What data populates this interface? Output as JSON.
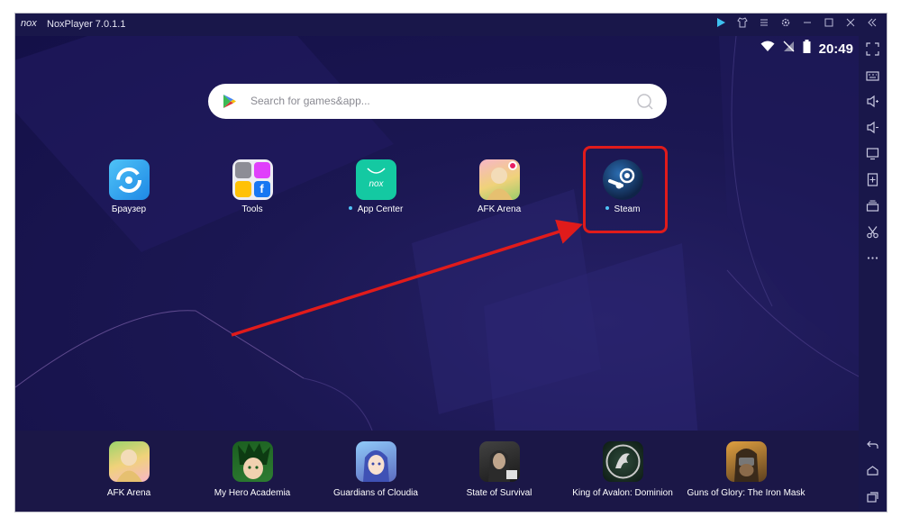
{
  "window": {
    "logo": "nox",
    "title": "NoxPlayer 7.0.1.1",
    "controls": [
      "play-icon",
      "shirt-icon",
      "menu-icon",
      "gear-icon",
      "minimize-icon",
      "maximize-icon",
      "close-icon",
      "collapse-icon"
    ]
  },
  "status": {
    "time": "20:49",
    "icons": [
      "wifi-icon",
      "no-signal-icon",
      "battery-icon"
    ]
  },
  "search": {
    "placeholder": "Search for games&app..."
  },
  "apps": [
    {
      "label": "Браузер",
      "icon": "browser-icon",
      "dot": false
    },
    {
      "label": "Tools",
      "icon": "tools-icon",
      "dot": false
    },
    {
      "label": "App Center",
      "icon": "app-center-icon",
      "dot": true
    },
    {
      "label": "AFK Arena",
      "icon": "afk-arena-icon",
      "dot": false
    },
    {
      "label": "Steam",
      "icon": "steam-icon",
      "dot": true
    }
  ],
  "dock": [
    {
      "label": "AFK Arena",
      "icon": "afk-arena-icon"
    },
    {
      "label": "My Hero Academia",
      "icon": "my-hero-academia-icon"
    },
    {
      "label": "Guardians of Cloudia",
      "icon": "guardians-of-cloudia-icon"
    },
    {
      "label": "State of Survival",
      "icon": "state-of-survival-icon"
    },
    {
      "label": "King of Avalon: Dominion",
      "icon": "king-of-avalon-icon"
    },
    {
      "label": "Guns of Glory: The Iron Mask",
      "icon": "guns-of-glory-icon"
    }
  ],
  "sidebar": [
    "fullscreen-icon",
    "keyboard-icon",
    "volume-up-icon",
    "volume-down-icon",
    "screen-icon",
    "add-apk-icon",
    "multi-instance-icon",
    "scissors-icon",
    "more-icon",
    "back-icon",
    "home-icon",
    "recent-apps-icon"
  ],
  "colors": {
    "accent_red": "#e01b1b",
    "background": "#1a1550",
    "dot": "#4fc3f7"
  }
}
